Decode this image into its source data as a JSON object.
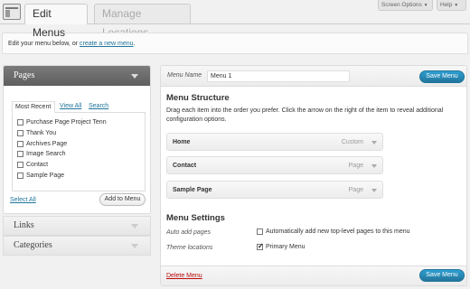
{
  "tabs": {
    "edit": "Edit Menus",
    "manage": "Manage Locations"
  },
  "top_buttons": {
    "screen_options": "Screen Options",
    "help": "Help"
  },
  "manage_bar": {
    "text": "Edit your menu below, or ",
    "link": "create a new menu",
    "suffix": "."
  },
  "pages_panel": {
    "title": "Pages",
    "tabs": [
      "Most Recent",
      "View All",
      "Search"
    ],
    "items": [
      "Purchase Page Project Tenn",
      "Thank You",
      "Archives Page",
      "Image Search",
      "Contact",
      "Sample Page"
    ],
    "select_all": "Select All",
    "add_button": "Add to Menu"
  },
  "accordion": {
    "links": "Links",
    "categories": "Categories"
  },
  "menu_editor": {
    "name_label": "Menu Name",
    "name_value": "Menu 1",
    "save_label": "Save Menu",
    "structure_heading": "Menu Structure",
    "instructions": "Drag each item into the order you prefer. Click the arrow on the right of the item to reveal additional configuration options.",
    "items": [
      {
        "title": "Home",
        "type": "Custom"
      },
      {
        "title": "Contact",
        "type": "Page"
      },
      {
        "title": "Sample Page",
        "type": "Page"
      }
    ],
    "settings_heading": "Menu Settings",
    "auto_add_label": "Auto add pages",
    "auto_add_option": "Automatically add new top-level pages to this menu",
    "auto_add_checked": false,
    "theme_locations_label": "Theme locations",
    "primary_menu_option": "Primary Menu",
    "primary_menu_checked": true,
    "delete_label": "Delete Menu"
  }
}
